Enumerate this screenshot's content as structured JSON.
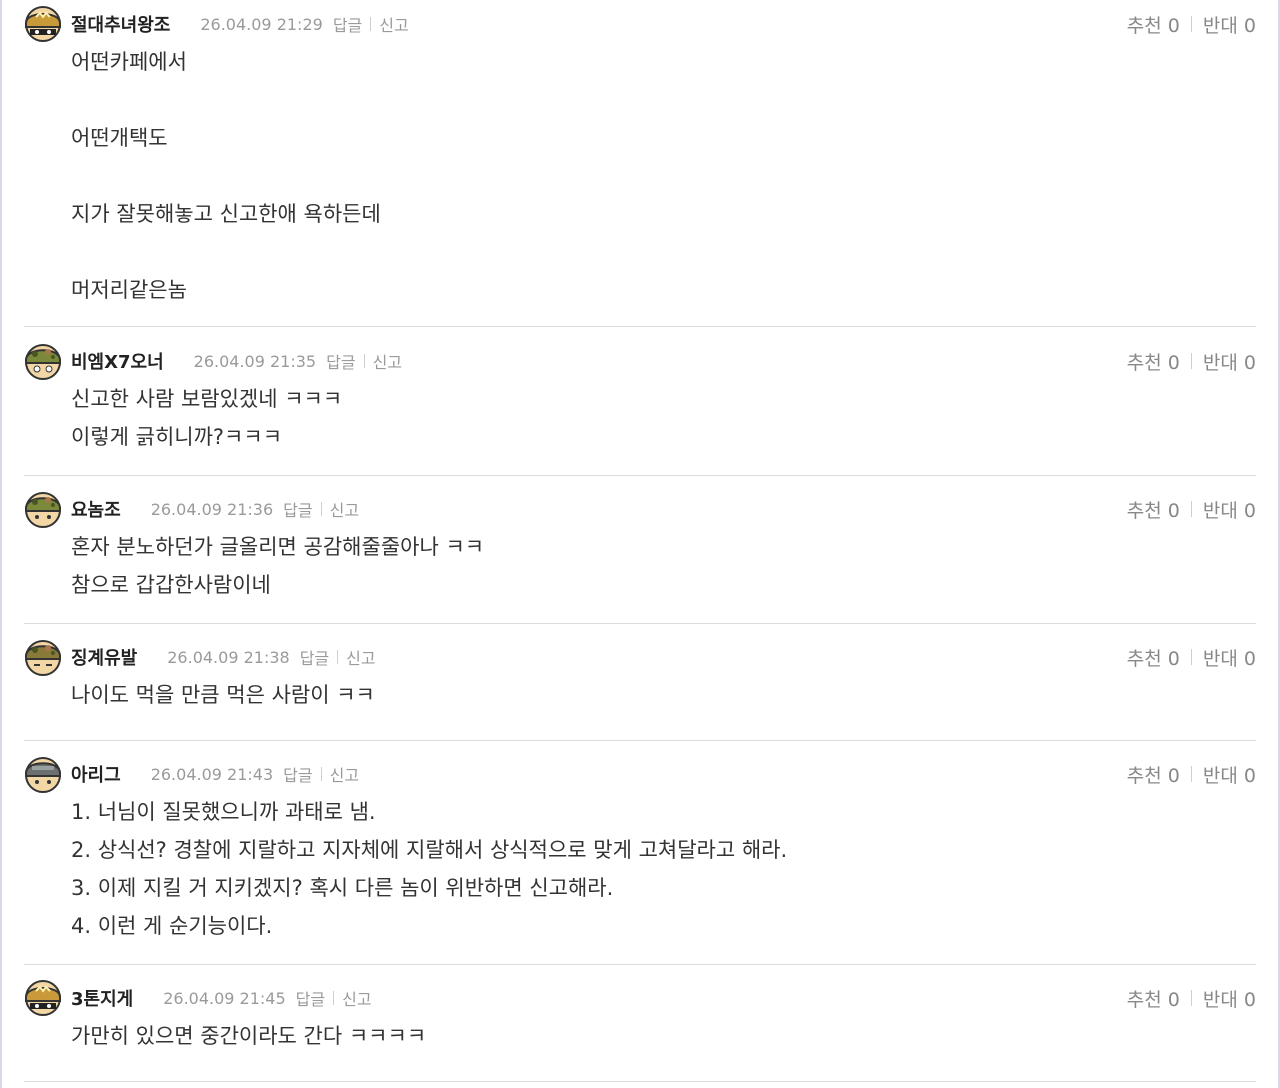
{
  "labels": {
    "reply": "답글",
    "report": "신고",
    "upvote": "추천",
    "downvote": "반대"
  },
  "colors": {
    "helmet_gold": "#c99a3a",
    "helmet_camo": "#7a8a3a",
    "helmet_gray": "#6b6f70",
    "face": "#f3d6a6",
    "divider": "#dcdcdc",
    "meta_text": "#9a9a9a"
  },
  "comments": [
    {
      "nickname": "절대추녀왕조",
      "datetime": "26.04.09 21:29",
      "upvotes": "0",
      "downvotes": "0",
      "avatar_icon": "gold-helmet-avatar-icon",
      "lines": [
        "어떤카페에서",
        "",
        "어떤개택도",
        "",
        "지가 잘못해놓고 신고한애 욕하든데",
        "",
        "머저리같은놈"
      ]
    },
    {
      "nickname": "비엠X7오너",
      "datetime": "26.04.09 21:35",
      "upvotes": "0",
      "downvotes": "0",
      "avatar_icon": "camo-helmet-avatar-icon",
      "lines": [
        "신고한 사람 보람있겠네 ㅋㅋㅋ",
        "이렇게 긁히니까?ㅋㅋㅋ"
      ]
    },
    {
      "nickname": "요놈조",
      "datetime": "26.04.09 21:36",
      "upvotes": "0",
      "downvotes": "0",
      "avatar_icon": "camo-helmet-avatar-icon",
      "lines": [
        "혼자 분노하던가 글올리면 공감해줄줄아나 ㅋㅋ",
        "참으로 갑갑한사람이네"
      ]
    },
    {
      "nickname": "징계유발",
      "datetime": "26.04.09 21:38",
      "upvotes": "0",
      "downvotes": "0",
      "avatar_icon": "camo-helmet-avatar-icon",
      "lines": [
        "나이도 먹을 만큼 먹은 사람이 ㅋㅋ"
      ]
    },
    {
      "nickname": "아리그",
      "datetime": "26.04.09 21:43",
      "upvotes": "0",
      "downvotes": "0",
      "avatar_icon": "gray-helmet-avatar-icon",
      "lines": [
        "1. 너님이 질못했으니까 과태로 냄.",
        "2. 상식선? 경찰에 지랄하고 지자체에 지랄해서 상식적으로 맞게 고쳐달라고 해라.",
        "3. 이제 지킬 거 지키겠지? 혹시 다른 놈이 위반하면 신고해라.",
        "4. 이런 게 순기능이다."
      ]
    },
    {
      "nickname": "3톤지게",
      "datetime": "26.04.09 21:45",
      "upvotes": "0",
      "downvotes": "0",
      "avatar_icon": "gold-helmet-avatar-icon",
      "lines": [
        "가만히 있으면 중간이라도 간다 ㅋㅋㅋㅋ"
      ]
    }
  ]
}
